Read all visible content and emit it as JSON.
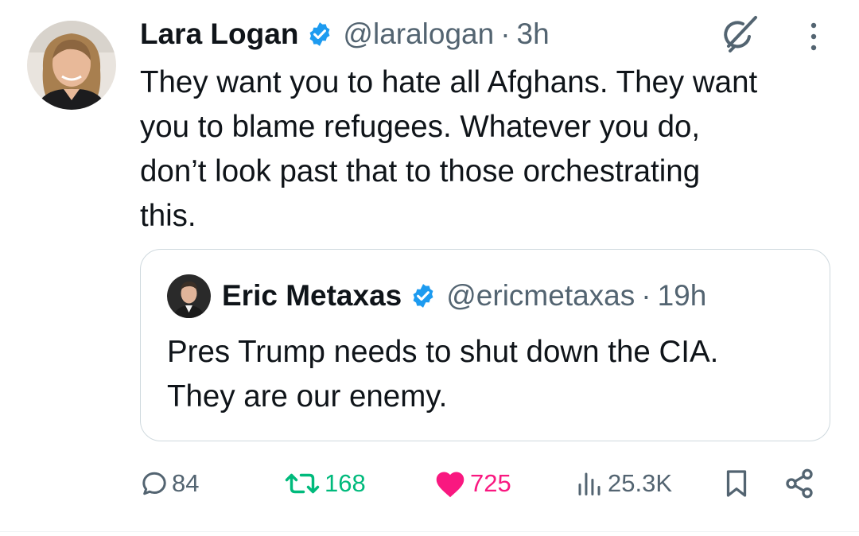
{
  "tweet": {
    "author": {
      "name": "Lara Logan",
      "handle": "@laralogan",
      "verified": true,
      "avatar_icon": "user-photo"
    },
    "separator": "·",
    "time": "3h",
    "text_lines": [
      "They want you to hate all Afghans. They want",
      "you to blame refugees. Whatever you do,",
      "don’t look past that to those orchestrating",
      "this."
    ],
    "quote": {
      "author": {
        "name": "Eric Metaxas",
        "handle": "@ericmetaxas",
        "verified": true,
        "avatar_icon": "user-photo"
      },
      "separator": "·",
      "time": "19h",
      "text_lines": [
        "Pres Trump needs to shut down the CIA.",
        "They are our enemy."
      ]
    },
    "actions": {
      "replies": "84",
      "retweets": "168",
      "likes": "725",
      "views": "25.3K"
    }
  },
  "colors": {
    "text": "#0f1419",
    "secondary": "#536471",
    "verified": "#1d9bf0",
    "retweet": "#00ba7c",
    "like": "#f91880",
    "border": "#cfd9de"
  },
  "icons": [
    "verified-badge-icon",
    "grok-icon",
    "more-icon",
    "reply-icon",
    "retweet-icon",
    "like-icon",
    "views-icon",
    "bookmark-icon",
    "share-icon"
  ]
}
